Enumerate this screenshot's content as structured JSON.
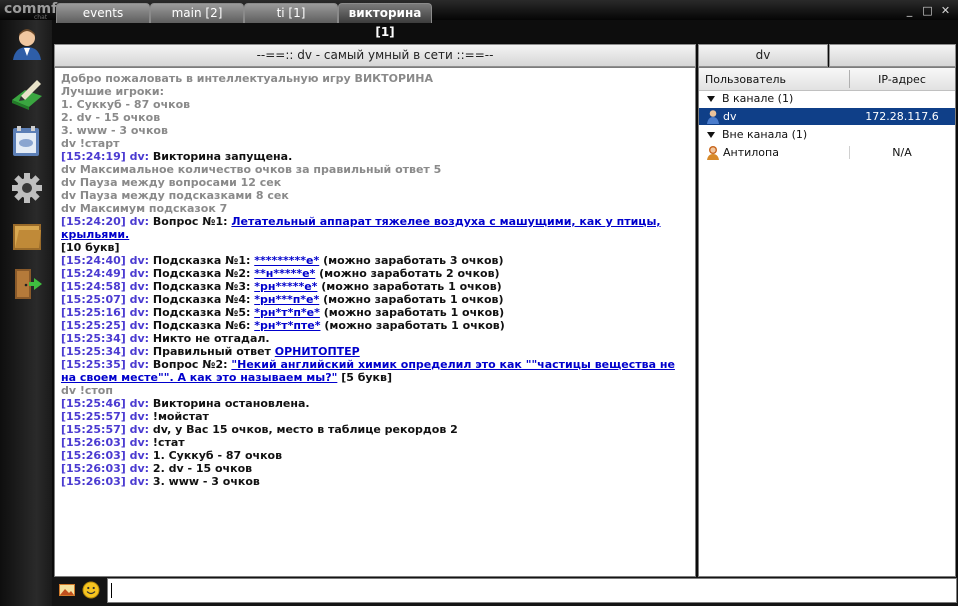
{
  "app": {
    "logo": "commfort",
    "logo_sub": "chat"
  },
  "window_controls": {
    "minimize": "_",
    "maximize": "□",
    "close": "✕"
  },
  "left_toolbar": [
    {
      "name": "user-profile-icon"
    },
    {
      "name": "edit-icon"
    },
    {
      "name": "channel-icon"
    },
    {
      "name": "settings-gear-icon"
    },
    {
      "name": "folder-icon"
    },
    {
      "name": "exit-door-icon"
    }
  ],
  "tabs": [
    {
      "label": "events"
    },
    {
      "label": "main [2]"
    },
    {
      "label": "ti [1]"
    },
    {
      "label": "викторина [1]"
    }
  ],
  "topic": "--==:: dv - самый умный в сети ::==--",
  "current_nick": "dv",
  "chat": [
    {
      "kind": "sys",
      "text": "Добро пожаловать в интеллектуальную игру ВИКТОРИНА"
    },
    {
      "kind": "sys",
      "text": "Лучшие игроки:"
    },
    {
      "kind": "sys",
      "text": "1. Суккуб - 87 очков"
    },
    {
      "kind": "sys",
      "text": "2. dv - 15 очков"
    },
    {
      "kind": "sys",
      "text": "3. www - 3 очков"
    },
    {
      "kind": "sys",
      "text": "dv !старт"
    },
    {
      "kind": "msg",
      "ts": "[15:24:19]",
      "nick": "dv:",
      "text": "Викторина запущена."
    },
    {
      "kind": "sys",
      "text": "dv Максимальное количество очков за правильный ответ 5"
    },
    {
      "kind": "sys",
      "text": "dv Пауза между вопросами 12 сек"
    },
    {
      "kind": "sys",
      "text": "dv Пауза между подсказками 8 сек"
    },
    {
      "kind": "sys",
      "text": "dv Максимум подсказок 7"
    },
    {
      "kind": "msg",
      "ts": "[15:24:20]",
      "nick": "dv:",
      "text": "Вопрос №1:",
      "link": "Летательный аппарат тяжелее воздуха с машущими, как у птицы, крыльями.",
      "after": ""
    },
    {
      "kind": "plain",
      "text": "[10 букв]"
    },
    {
      "kind": "msg",
      "ts": "[15:24:40]",
      "nick": "dv:",
      "text": "Подсказка №1:",
      "link": "*********е*",
      "after": "(можно заработать 3 очков)"
    },
    {
      "kind": "msg",
      "ts": "[15:24:49]",
      "nick": "dv:",
      "text": "Подсказка №2:",
      "link": "**н*****е*",
      "after": "(можно заработать 2 очков)"
    },
    {
      "kind": "msg",
      "ts": "[15:24:58]",
      "nick": "dv:",
      "text": "Подсказка №3:",
      "link": "*рн*****е*",
      "after": "(можно заработать 1 очков)"
    },
    {
      "kind": "msg",
      "ts": "[15:25:07]",
      "nick": "dv:",
      "text": "Подсказка №4:",
      "link": "*рн***п*е*",
      "after": "(можно заработать 1 очков)"
    },
    {
      "kind": "msg",
      "ts": "[15:25:16]",
      "nick": "dv:",
      "text": "Подсказка №5:",
      "link": "*рн*т*п*е*",
      "after": "(можно заработать 1 очков)"
    },
    {
      "kind": "msg",
      "ts": "[15:25:25]",
      "nick": "dv:",
      "text": "Подсказка №6:",
      "link": "*рн*т*пте*",
      "after": "(можно заработать 1 очков)"
    },
    {
      "kind": "msg",
      "ts": "[15:25:34]",
      "nick": "dv:",
      "text": "Никто не отгадал."
    },
    {
      "kind": "msg",
      "ts": "[15:25:34]",
      "nick": "dv:",
      "text": "Правильный ответ",
      "link": "ОРНИТОПТЕР",
      "after": ""
    },
    {
      "kind": "msg",
      "ts": "[15:25:35]",
      "nick": "dv:",
      "text": "Вопрос №2:",
      "link": "\"Некий английский химик определил это как \"\"частицы вещества не на своем месте\"\". А как это называем мы?\"",
      "after": "[5 букв]"
    },
    {
      "kind": "sys",
      "text": "dv !стоп"
    },
    {
      "kind": "msg",
      "ts": "[15:25:46]",
      "nick": "dv:",
      "text": "Викторина остановлена."
    },
    {
      "kind": "msg",
      "ts": "[15:25:57]",
      "nick": "dv:",
      "text": "!мойстат"
    },
    {
      "kind": "msg",
      "ts": "[15:25:57]",
      "nick": "dv:",
      "text": "dv, у Вас 15 очков, место в таблице рекордов 2"
    },
    {
      "kind": "msg",
      "ts": "[15:26:03]",
      "nick": "dv:",
      "text": "!стат"
    },
    {
      "kind": "msg",
      "ts": "[15:26:03]",
      "nick": "dv:",
      "text": "1. Суккуб - 87 очков"
    },
    {
      "kind": "msg",
      "ts": "[15:26:03]",
      "nick": "dv:",
      "text": "2. dv - 15 очков"
    },
    {
      "kind": "msg",
      "ts": "[15:26:03]",
      "nick": "dv:",
      "text": "3. www - 3 очков"
    }
  ],
  "userlist": {
    "col_user": "Пользователь",
    "col_ip": "IP-адрес",
    "in_channel_label": "В канале (1)",
    "in_channel": [
      {
        "name": "dv",
        "ip": "172.28.117.6"
      }
    ],
    "out_channel_label": "Вне канала (1)",
    "out_channel": [
      {
        "name": "Антилопа",
        "ip": "N/A"
      }
    ]
  },
  "bottom_icons": [
    "image-icon",
    "smiley-icon"
  ],
  "input": {
    "value": ""
  }
}
